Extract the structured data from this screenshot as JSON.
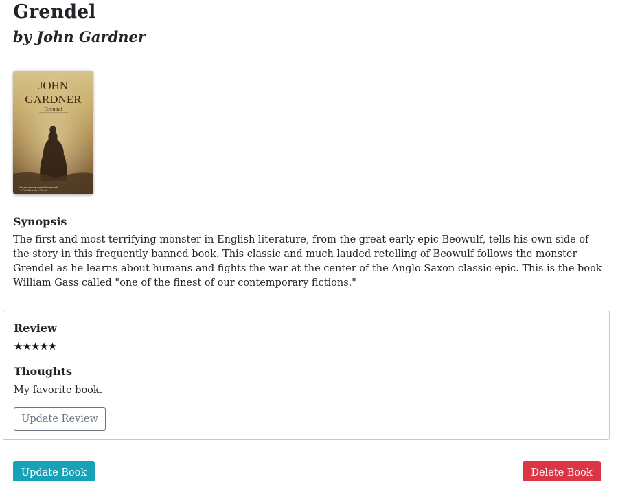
{
  "book": {
    "title": "Grendel",
    "author_line": "by John Gardner",
    "cover": {
      "author_text": "JOHN GARDNER",
      "author_first": "JOHN",
      "author_last": "GARDNER",
      "title_text": "Grendel",
      "quote_line1": "\"An extraordinary achievement\"",
      "quote_line2": "—The New York Times"
    }
  },
  "synopsis": {
    "heading": "Synopsis",
    "text": "The first and most terrifying monster in English literature, from the great early epic Beowulf, tells his own side of the story in this frequently banned book. This classic and much lauded retelling of Beowulf follows the monster Grendel as he learns about humans and fights the war at the center of the Anglo Saxon classic epic. This is the book William Gass called \"one of the finest of our contemporary fictions.\""
  },
  "review": {
    "heading": "Review",
    "stars": "★★★★★",
    "rating": 5,
    "rating_max": 5,
    "thoughts_heading": "Thoughts",
    "thoughts_text": "My favorite book.",
    "update_review_label": "Update Review"
  },
  "actions": {
    "update_book_label": "Update Book",
    "delete_book_label": "Delete Book"
  },
  "colors": {
    "update_book": "#17a2b8",
    "delete_book": "#dc3545",
    "outline_button": "#6c757d",
    "text": "#212529"
  }
}
